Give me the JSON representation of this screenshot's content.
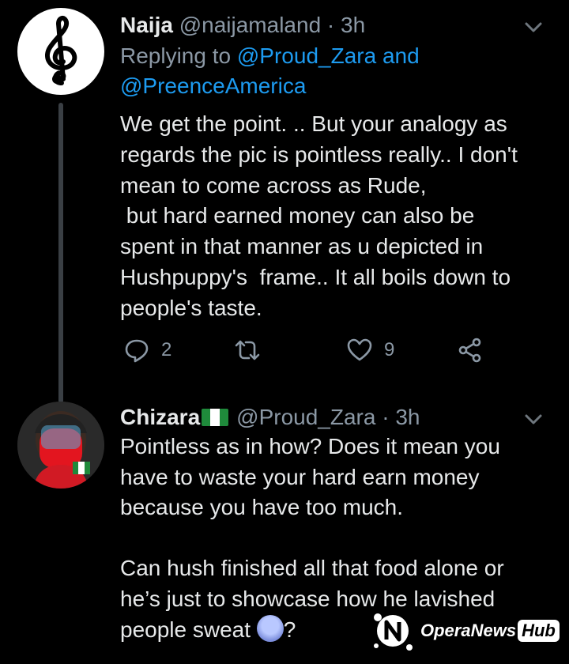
{
  "tweet1": {
    "name": "Naija",
    "handle": "@naijamaland",
    "separator": "·",
    "time": "3h",
    "replying_prefix": "Replying to",
    "replying_handle1": "@Proud_Zara",
    "replying_and": "and",
    "replying_handle2": "@PreenceAmerica",
    "text": "We get the point. .. But your analogy as\nregards the pic is pointless really.. I don't\nmean to come across as Rude,\n but hard earned money can also be\nspent in that manner as u depicted in\nHushpuppy's  frame.. It all boils down to\npeople's taste.",
    "reply_count": "2",
    "like_count": "9",
    "avatar_icon": "treble-clef-icon"
  },
  "tweet2": {
    "name": "Chizara",
    "name_emoji": "nigeria-flag-icon",
    "handle": "@Proud_Zara",
    "separator": "·",
    "time": "3h",
    "text_main": "Pointless as in how? Does it mean you\nhave to waste your hard earn money\nbecause you have too much.\n\nCan hush finished all that food alone or\nhe’s just to showcase how he lavished\npeople sweat ",
    "text_end": "?",
    "emoji": "sweat-face-icon"
  },
  "watermark": {
    "brand": "OperaNews",
    "hub": "Hub"
  },
  "colors": {
    "background": "#000000",
    "text": "#e7e9ea",
    "muted": "#8b98a5",
    "link": "#1d9bf0",
    "thread_line": "#3a3f44"
  }
}
